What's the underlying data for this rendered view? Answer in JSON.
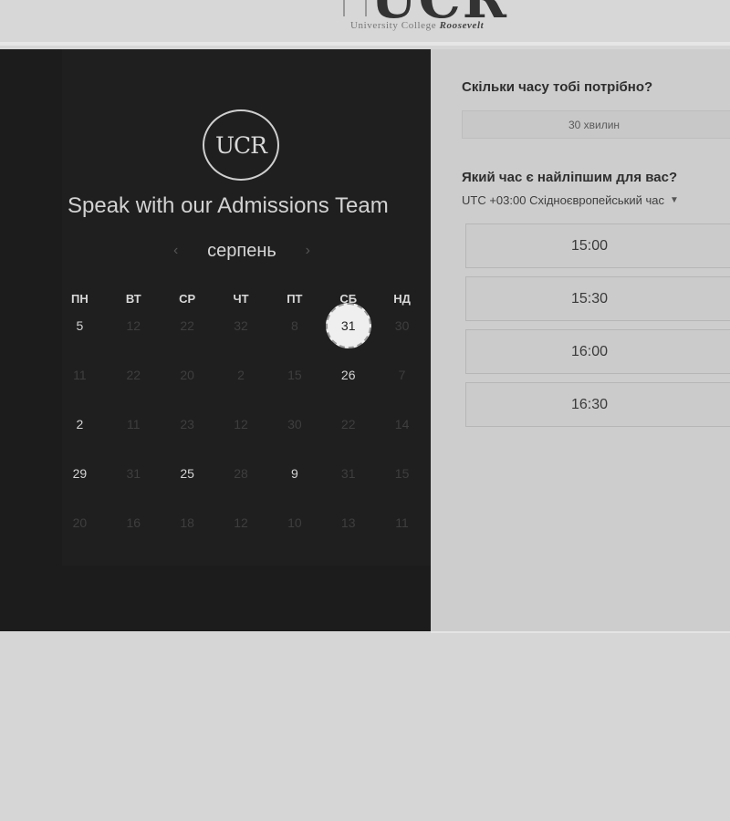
{
  "logo": {
    "text": "UCR",
    "subtitle": "University College",
    "subtitle_bold": "Roosevelt"
  },
  "calendar_panel": {
    "badge_text": "UCR",
    "title": "Speak with our Admissions Team",
    "month": "серпень",
    "weekdays": [
      "ПН",
      "ВТ",
      "СР",
      "ЧТ",
      "ПТ",
      "СБ",
      "НД"
    ],
    "weeks": [
      [
        {
          "d": "5",
          "a": true
        },
        {
          "d": "12",
          "a": false
        },
        {
          "d": "22",
          "a": false
        },
        {
          "d": "32",
          "a": false
        },
        {
          "d": "8",
          "a": false
        },
        {
          "d": "31",
          "a": true,
          "selected": true
        },
        {
          "d": "30",
          "a": false
        }
      ],
      [
        {
          "d": "11",
          "a": false
        },
        {
          "d": "22",
          "a": false
        },
        {
          "d": "20",
          "a": false
        },
        {
          "d": "2",
          "a": false
        },
        {
          "d": "15",
          "a": false
        },
        {
          "d": "26",
          "a": true
        },
        {
          "d": "7",
          "a": false
        }
      ],
      [
        {
          "d": "2",
          "a": true
        },
        {
          "d": "11",
          "a": false
        },
        {
          "d": "23",
          "a": false
        },
        {
          "d": "12",
          "a": false
        },
        {
          "d": "30",
          "a": false
        },
        {
          "d": "22",
          "a": false
        },
        {
          "d": "14",
          "a": false
        }
      ],
      [
        {
          "d": "29",
          "a": true
        },
        {
          "d": "31",
          "a": false
        },
        {
          "d": "25",
          "a": true
        },
        {
          "d": "28",
          "a": false
        },
        {
          "d": "9",
          "a": true
        },
        {
          "d": "31",
          "a": false
        },
        {
          "d": "15",
          "a": false
        }
      ],
      [
        {
          "d": "20",
          "a": false
        },
        {
          "d": "16",
          "a": false
        },
        {
          "d": "18",
          "a": false
        },
        {
          "d": "12",
          "a": false
        },
        {
          "d": "10",
          "a": false
        },
        {
          "d": "13",
          "a": false
        },
        {
          "d": "11",
          "a": false
        }
      ]
    ]
  },
  "booking_panel": {
    "duration_question": "Скільки часу тобі потрібно?",
    "duration_value": "30 хвилин",
    "time_question": "Який час є найліпшим для вас?",
    "timezone": "UTC +03:00 Східноєвропейський час",
    "slots": [
      "15:00",
      "15:30",
      "16:00",
      "16:30"
    ]
  }
}
